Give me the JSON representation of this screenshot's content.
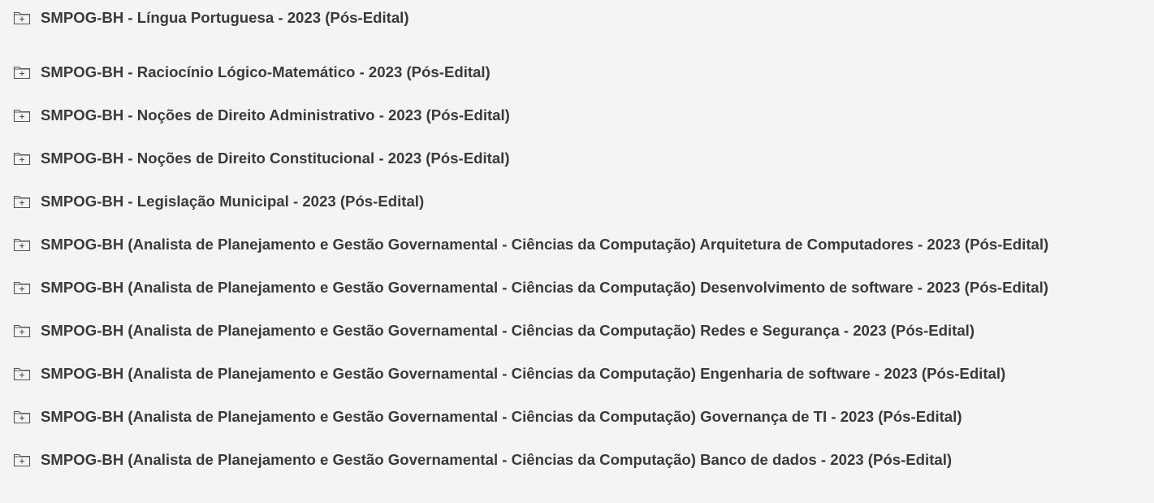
{
  "folders": {
    "items": [
      {
        "label": "SMPOG-BH - Língua Portuguesa - 2023 (Pós-Edital)",
        "icon": "folder-plus-icon"
      },
      {
        "label": "SMPOG-BH - Raciocínio Lógico-Matemático - 2023 (Pós-Edital)",
        "icon": "folder-plus-icon"
      },
      {
        "label": "SMPOG-BH - Noções de Direito Administrativo - 2023 (Pós-Edital)",
        "icon": "folder-plus-icon"
      },
      {
        "label": "SMPOG-BH - Noções de Direito Constitucional - 2023 (Pós-Edital)",
        "icon": "folder-plus-icon"
      },
      {
        "label": "SMPOG-BH - Legislação Municipal - 2023 (Pós-Edital)",
        "icon": "folder-plus-icon"
      },
      {
        "label": "SMPOG-BH (Analista de Planejamento e Gestão Governamental - Ciências da Computação) Arquitetura de Computadores - 2023 (Pós-Edital)",
        "icon": "folder-plus-icon"
      },
      {
        "label": "SMPOG-BH (Analista de Planejamento e Gestão Governamental - Ciências da Computação) Desenvolvimento de software - 2023 (Pós-Edital)",
        "icon": "folder-plus-icon"
      },
      {
        "label": "SMPOG-BH (Analista de Planejamento e Gestão Governamental - Ciências da Computação) Redes e Segurança - 2023 (Pós-Edital)",
        "icon": "folder-plus-icon"
      },
      {
        "label": "SMPOG-BH (Analista de Planejamento e Gestão Governamental - Ciências da Computação) Engenharia de software - 2023 (Pós-Edital)",
        "icon": "folder-plus-icon"
      },
      {
        "label": "SMPOG-BH (Analista de Planejamento e Gestão Governamental - Ciências da Computação) Governança de TI - 2023 (Pós-Edital)",
        "icon": "folder-plus-icon"
      },
      {
        "label": "SMPOG-BH (Analista de Planejamento e Gestão Governamental - Ciências da Computação) Banco de dados - 2023 (Pós-Edital)",
        "icon": "folder-plus-icon"
      }
    ]
  },
  "colors": {
    "background": "#f4f4f4",
    "text": "#3a3a3a",
    "icon_stroke": "#555555"
  }
}
